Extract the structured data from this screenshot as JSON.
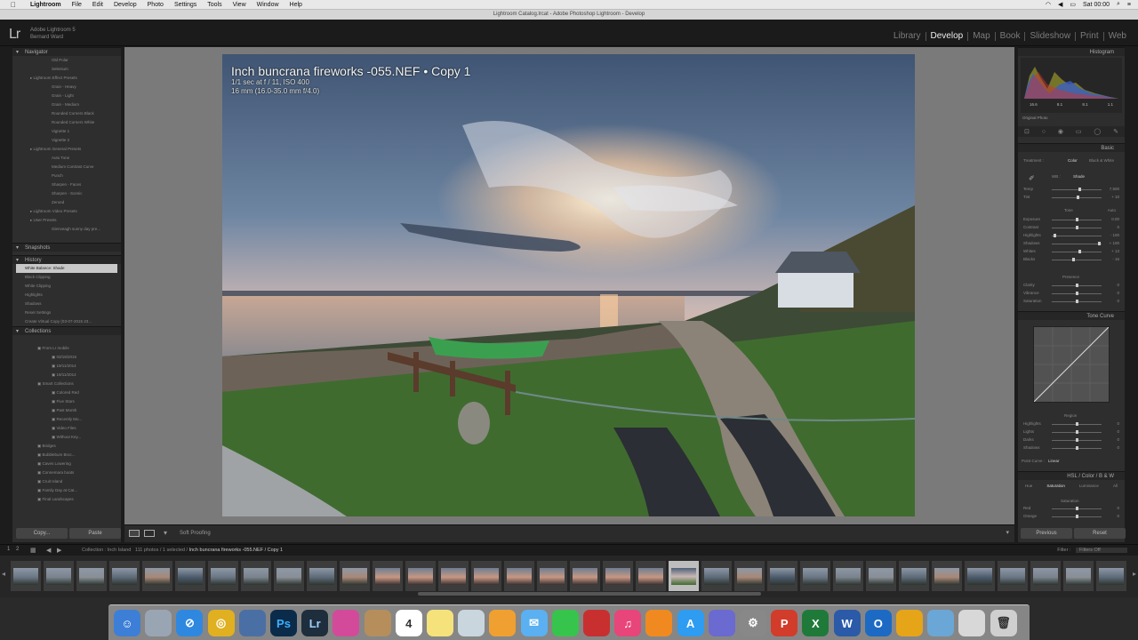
{
  "macos_menubar": {
    "apple": "",
    "menus": [
      "Lightroom",
      "File",
      "Edit",
      "Develop",
      "Photo",
      "Settings",
      "Tools",
      "View",
      "Window",
      "Help"
    ],
    "clock": "Sat 00:00"
  },
  "window_title": "Lightroom Catalog.lrcat - Adobe Photoshop Lightroom - Develop",
  "lr": {
    "logo": "Lr",
    "identity_line1": "Adobe Lightroom 5",
    "identity_line2": "Bernard Ward",
    "modules": [
      "Library",
      "Develop",
      "Map",
      "Book",
      "Slideshow",
      "Print",
      "Web"
    ],
    "active_module": "Develop"
  },
  "left_panel": {
    "navigator": "Navigator",
    "presets": [
      "Old Polar",
      "Selenium",
      "Lightroom Effect Presets",
      "Grain - Heavy",
      "Grain - Light",
      "Grain - Medium",
      "Rounded Corners Black",
      "Rounded Corners White",
      "Vignette 1",
      "Vignette 2",
      "Lightroom General Presets",
      "Auto Tone",
      "Medium Contrast Curve",
      "Punch",
      "Sharpen - Faces",
      "Sharpen - Scenic",
      "Zeroed",
      "Lightroom Video Presets",
      "User Presets",
      "Glenveagh sunny day pre..."
    ],
    "snapshots": "Snapshots",
    "history": "History",
    "history_items": [
      {
        "label": "White Balance: Shade",
        "value": ""
      },
      {
        "label": "Black Clipping",
        "value": ""
      },
      {
        "label": "White Clipping",
        "value": ""
      },
      {
        "label": "Highlights",
        "value": ""
      },
      {
        "label": "Shadows",
        "value": ""
      },
      {
        "label": "Reset Settings",
        "value": ""
      },
      {
        "label": "Create Virtual Copy (03-07-2015 23...",
        "value": ""
      }
    ],
    "collections": "Collections",
    "collection_items": [
      {
        "label": "From Lr mobile",
        "count": ""
      },
      {
        "label": "03/18/2015",
        "count": ""
      },
      {
        "label": "19/11/2014",
        "count": ""
      },
      {
        "label": "19/11/2014",
        "count": ""
      },
      {
        "label": "Smart Collections",
        "count": ""
      },
      {
        "label": "Colored Red",
        "count": ""
      },
      {
        "label": "Five Stars",
        "count": ""
      },
      {
        "label": "Past Month",
        "count": ""
      },
      {
        "label": "Recently Mo...",
        "count": ""
      },
      {
        "label": "Video Files",
        "count": ""
      },
      {
        "label": "Without Key...",
        "count": ""
      },
      {
        "label": "Bridges",
        "count": ""
      },
      {
        "label": "Bubblebum Broc...",
        "count": ""
      },
      {
        "label": "Caves Lowering",
        "count": ""
      },
      {
        "label": "Connemara boats",
        "count": ""
      },
      {
        "label": "Cruit Island",
        "count": ""
      },
      {
        "label": "Family Day at Cat...",
        "count": ""
      },
      {
        "label": "Final Landscapes",
        "count": ""
      }
    ],
    "copy_button": "Copy...",
    "paste_button": "Paste"
  },
  "photo": {
    "title": "Inch buncrana fireworks -055.NEF  •  Copy 1",
    "exif_line1": "1/1 sec at f / 11, ISO 400",
    "exif_line2": "16 mm (16.0-35.0 mm f/4.0)"
  },
  "toolbar": {
    "soft_proofing": "Soft Proofing"
  },
  "right_panel": {
    "histogram": "Histogram",
    "hist_readout": [
      "16.6",
      "8.1",
      "8.1",
      "1.1"
    ],
    "original_photo": "Original Photo",
    "basic": "Basic",
    "treatment_label": "Treatment :",
    "treatment_color": "Color",
    "treatment_bw": "Black & White",
    "wb_label": "WB :",
    "wb_value": "Shade",
    "basic_sliders": [
      {
        "label": "Temp",
        "value": "7,500",
        "pos": 0.55
      },
      {
        "label": "Tint",
        "value": "+ 10",
        "pos": 0.52
      }
    ],
    "tone_label": "Tone",
    "tone_auto": "Auto",
    "tone_sliders": [
      {
        "label": "Exposure",
        "value": "0.00",
        "pos": 0.5
      },
      {
        "label": "Contrast",
        "value": "0",
        "pos": 0.5
      },
      {
        "label": "Highlights",
        "value": "- 100",
        "pos": 0.05
      },
      {
        "label": "Shadows",
        "value": "+ 100",
        "pos": 0.95
      },
      {
        "label": "Whites",
        "value": "+ 13",
        "pos": 0.56
      },
      {
        "label": "Blacks",
        "value": "- 16",
        "pos": 0.42
      }
    ],
    "presence_label": "Presence",
    "presence_sliders": [
      {
        "label": "Clarity",
        "value": "0",
        "pos": 0.5
      },
      {
        "label": "Vibrance",
        "value": "0",
        "pos": 0.5
      },
      {
        "label": "Saturation",
        "value": "0",
        "pos": 0.5
      }
    ],
    "tone_curve": "Tone Curve",
    "region_label": "Region",
    "region_sliders": [
      {
        "label": "Highlights",
        "value": "0",
        "pos": 0.5
      },
      {
        "label": "Lights",
        "value": "0",
        "pos": 0.5
      },
      {
        "label": "Darks",
        "value": "0",
        "pos": 0.5
      },
      {
        "label": "Shadows",
        "value": "0",
        "pos": 0.5
      }
    ],
    "point_curve_label": "Point Curve :",
    "point_curve_value": "Linear",
    "hsl": "HSL / Color / B & W",
    "hsl_tabs": [
      "Hue",
      "Saturation",
      "Luminance",
      "All"
    ],
    "saturation_label": "Saturation",
    "hsl_sliders": [
      {
        "label": "Red",
        "value": "0",
        "pos": 0.5
      },
      {
        "label": "Orange",
        "value": "0",
        "pos": 0.5
      }
    ],
    "previous_button": "Previous",
    "reset_button": "Reset"
  },
  "filmstrip": {
    "nav": [
      "1",
      "2"
    ],
    "info_prefix": "Collection : Inch Island",
    "info_count": "111 photos / 1 selected /",
    "info_file": "Inch buncrana fireworks -055.NEF / Copy 1",
    "filter_label": "Filter :",
    "filter_value": "Filters Off",
    "thumb_count": 34,
    "selected_index": 20
  },
  "dock": {
    "apps": [
      "Finder",
      "Launchpad",
      "Safari",
      "Chrome",
      "Preview",
      "Photoshop",
      "Lightroom",
      "Pinwheel",
      "Contacts",
      "Calendar",
      "Notes",
      "Preview2",
      "Photos",
      "Messages",
      "FaceTime",
      "Photo Booth",
      "iTunes",
      "iBooks",
      "App Store",
      "Dashboard",
      "System Preferences",
      "PowerPoint",
      "Excel",
      "Word",
      "Outlook",
      "Folder",
      "Pencil",
      "Downloads",
      "Trash"
    ],
    "calendar_day": "4"
  },
  "colors": {
    "lr_bg": "#1b1b1b",
    "panel_bg": "#2e2e2e",
    "center_bg": "#7a7a7a",
    "history_selected": "#c8c8c8",
    "active_module": "#eeeeee"
  }
}
